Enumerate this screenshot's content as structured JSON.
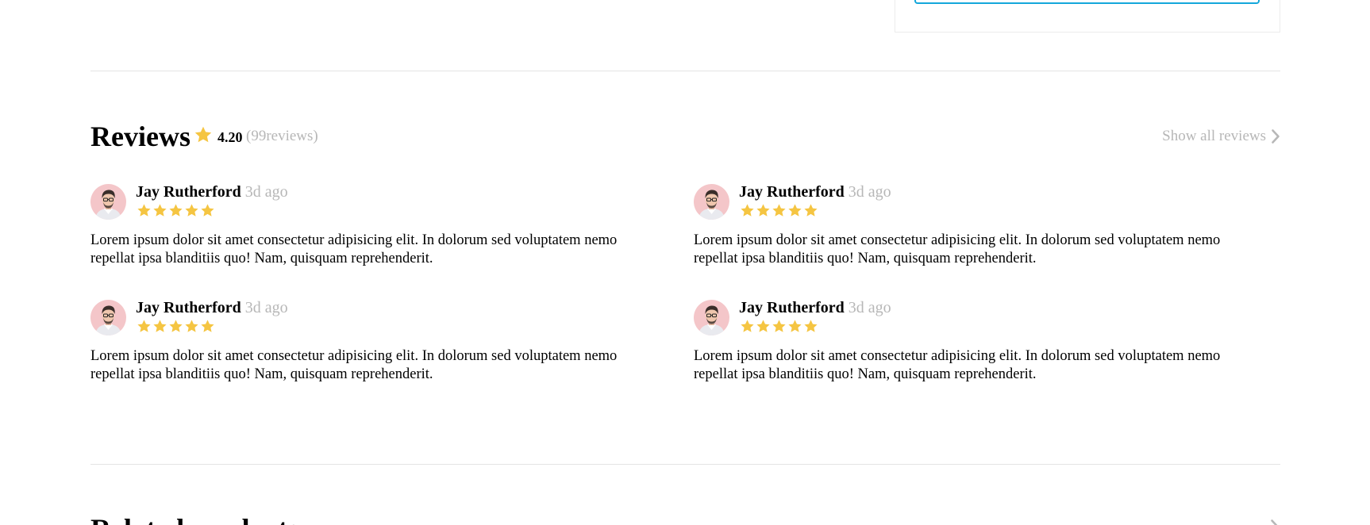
{
  "reviews": {
    "title": "Reviews",
    "rating": "4.20",
    "count": "(99reviews)",
    "show_all": "Show all reviews",
    "items": [
      {
        "name": "Jay Rutherford",
        "time": "3d ago",
        "stars": 5,
        "text": "Lorem ipsum dolor sit amet consectetur adipisicing elit. In dolorum sed voluptatem nemo repellat ipsa blanditiis quo! Nam, quisquam reprehenderit."
      },
      {
        "name": "Jay Rutherford",
        "time": "3d ago",
        "stars": 5,
        "text": "Lorem ipsum dolor sit amet consectetur adipisicing elit. In dolorum sed voluptatem nemo repellat ipsa blanditiis quo! Nam, quisquam reprehenderit."
      },
      {
        "name": "Jay Rutherford",
        "time": "3d ago",
        "stars": 5,
        "text": "Lorem ipsum dolor sit amet consectetur adipisicing elit. In dolorum sed voluptatem nemo repellat ipsa blanditiis quo! Nam, quisquam reprehenderit."
      },
      {
        "name": "Jay Rutherford",
        "time": "3d ago",
        "stars": 5,
        "text": "Lorem ipsum dolor sit amet consectetur adipisicing elit. In dolorum sed voluptatem nemo repellat ipsa blanditiis quo! Nam, quisquam reprehenderit."
      }
    ]
  },
  "related": {
    "title": "Related products"
  },
  "colors": {
    "star": "#f5c542",
    "muted": "#b7b7b7",
    "accent": "#14a7db",
    "divider": "#e4e4e4",
    "avatar_bg": "#f4c6c9"
  },
  "icons": {
    "rating": "star-icon",
    "show_all": "chevron-right-icon",
    "reviewer": "avatar"
  }
}
